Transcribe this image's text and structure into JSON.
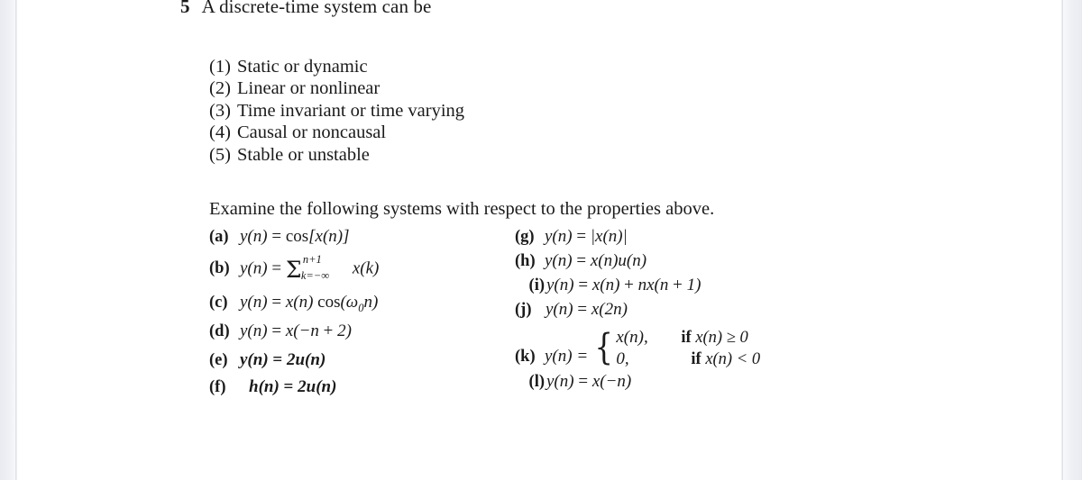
{
  "document": {
    "heading": {
      "number": "5",
      "text": "A discrete-time system can be"
    },
    "properties": [
      {
        "marker": "(1)",
        "text": "Static or dynamic"
      },
      {
        "marker": "(2)",
        "text": "Linear or nonlinear"
      },
      {
        "marker": "(3)",
        "text": "Time invariant or time varying"
      },
      {
        "marker": "(4)",
        "text": "Causal or noncausal"
      },
      {
        "marker": "(5)",
        "text": "Stable or unstable"
      }
    ],
    "instruction": "Examine the following systems with respect to the properties above.",
    "left_column": [
      {
        "label": "(a)",
        "equation": "y(n) = cos[x(n)]",
        "bold": false
      },
      {
        "label": "(b)",
        "equation": "y(n) = Σ k=-∞ to n+1 x(k)",
        "bold": false,
        "lhs": "y(n) =",
        "sum_upper": "n+1",
        "sum_lower": "k=−∞",
        "sum_term": "x(k)"
      },
      {
        "label": "(c)",
        "equation": "y(n) = x(n) cos(ω0n)",
        "bold": false
      },
      {
        "label": "(d)",
        "equation": "y(n) = x(−n + 2)",
        "bold": false
      },
      {
        "label": "(e)",
        "equation": "y(n) = 2u(n)",
        "bold": true
      },
      {
        "label": "(f)",
        "equation": "h(n) = 2u(n)",
        "bold": true
      }
    ],
    "right_column": [
      {
        "label": "(g)",
        "equation": "y(n) = |x(n)|",
        "bold": false
      },
      {
        "label": "(h)",
        "equation": "y(n) = x(n)u(n)",
        "bold": false
      },
      {
        "label": "(i)",
        "equation": "y(n) = x(n) + nx(n + 1)",
        "bold": false
      },
      {
        "label": "(j)",
        "equation": "y(n) = x(2n)",
        "bold": false
      },
      {
        "label": "(k)",
        "equation": "y(n) = piecewise",
        "bold": false,
        "lhs": "y(n) =",
        "cases": [
          {
            "value": "x(n),",
            "condition_keyword": "if",
            "condition": "x(n) ≥ 0"
          },
          {
            "value": "0,",
            "condition_keyword": "if",
            "condition": "x(n) < 0"
          }
        ]
      },
      {
        "label": "(l)",
        "equation": "y(n) = x(−n)",
        "bold": false
      }
    ]
  }
}
